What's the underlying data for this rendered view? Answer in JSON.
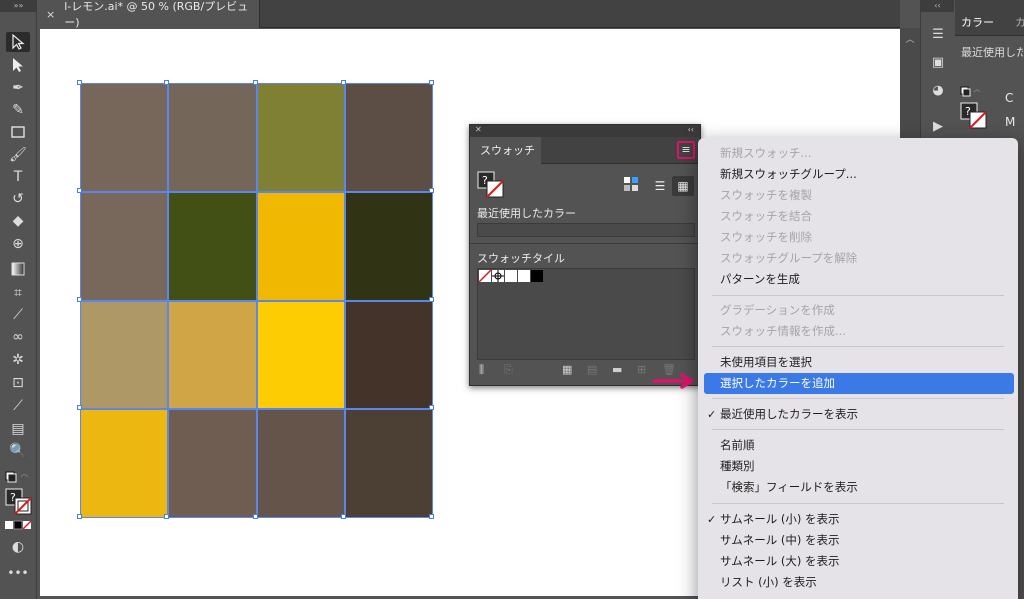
{
  "document": {
    "tab_title": "l-レモン.ai* @ 50 % (RGB/プレビュー)",
    "close_glyph": "×"
  },
  "artwork": {
    "cells": [
      "#77675a",
      "#75665a",
      "#808034",
      "#5c4e45",
      "#78685b",
      "#425016",
      "#f0b800",
      "#313414",
      "#ae9865",
      "#cfa545",
      "#fecc02",
      "#433328",
      "#edb711",
      "#6e5d50",
      "#645449",
      "#4c4034"
    ]
  },
  "swatches_panel": {
    "tab_label": "スウォッチ",
    "recent_label": "最近使用したカラー",
    "group_label": "スウォッチタイル",
    "menu_icon": "hamburger-icon",
    "swatch_colors": [
      "#ffffff",
      "#ffffff",
      "#000000"
    ]
  },
  "color_panel": {
    "tab_label": "カラー",
    "tab2_label": "カ",
    "recent_label": "最近使用した",
    "channels": [
      "C",
      "M"
    ]
  },
  "context_menu": {
    "items": [
      {
        "label": "新規スウォッチ...",
        "disabled": true
      },
      {
        "label": "新規スウォッチグループ...",
        "disabled": false
      },
      {
        "label": "スウォッチを複製",
        "disabled": true
      },
      {
        "label": "スウォッチを結合",
        "disabled": true
      },
      {
        "label": "スウォッチを削除",
        "disabled": true
      },
      {
        "label": "スウォッチグループを解除",
        "disabled": true
      },
      {
        "label": "パターンを生成",
        "disabled": false
      },
      {
        "label": "グラデーションを作成",
        "disabled": true
      },
      {
        "label": "スウォッチ情報を作成...",
        "disabled": true
      },
      {
        "label": "未使用項目を選択",
        "disabled": false
      },
      {
        "label": "選択したカラーを追加",
        "disabled": false,
        "highlighted": true
      },
      {
        "label": "最近使用したカラーを表示",
        "disabled": false,
        "checked": true
      },
      {
        "label": "名前順",
        "disabled": false
      },
      {
        "label": "種類別",
        "disabled": false
      },
      {
        "label": "「検索」フィールドを表示",
        "disabled": false
      },
      {
        "label": "サムネール (小) を表示",
        "disabled": false,
        "checked": true
      },
      {
        "label": "サムネール (中) を表示",
        "disabled": false
      },
      {
        "label": "サムネール (大) を表示",
        "disabled": false
      },
      {
        "label": "リスト (小) を表示",
        "disabled": false
      }
    ]
  },
  "colors": {
    "menu_highlight": "#3a79e6",
    "annotation_pink": "#e0126a",
    "selection_blue": "#5a86f0"
  }
}
